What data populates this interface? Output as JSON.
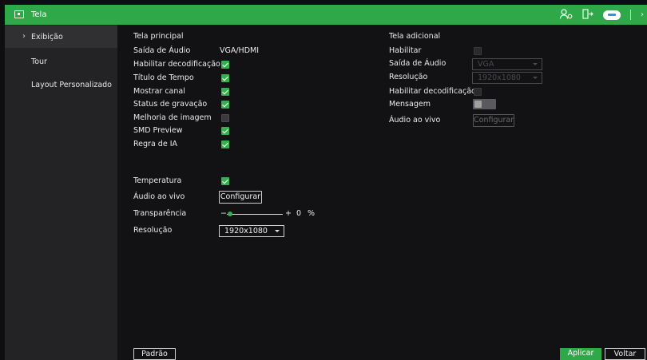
{
  "window": {
    "title": "Tela"
  },
  "titlebar": {
    "icons": [
      "user-settings-icon",
      "logout-icon",
      "cloud-icon",
      "expand-icon"
    ]
  },
  "sidebar": {
    "items": [
      {
        "label": "Exibição",
        "active": true
      },
      {
        "label": "Tour",
        "active": false
      },
      {
        "label": "Layout Personalizado",
        "active": false
      }
    ]
  },
  "main_screen": {
    "header": "Tela principal",
    "audio_output": {
      "label": "Saída de Áudio",
      "value": "VGA/HDMI"
    },
    "decoding": {
      "label": "Habilitar decodificação",
      "checked": true
    },
    "time_title": {
      "label": "Título de Tempo",
      "checked": true
    },
    "show_channel": {
      "label": "Mostrar canal",
      "checked": true
    },
    "record_status": {
      "label": "Status de gravação",
      "checked": true
    },
    "image_enhance": {
      "label": "Melhoria de imagem",
      "checked": false
    },
    "smd_preview": {
      "label": "SMD Preview",
      "checked": true
    },
    "ai_rule": {
      "label": "Regra de IA",
      "checked": true
    },
    "temperature": {
      "label": "Temperatura",
      "checked": true
    },
    "live_audio": {
      "label": "Áudio ao vivo",
      "button": "Configurar"
    },
    "transparency": {
      "label": "Transparência",
      "minus": "−",
      "plus": "+",
      "value": "0",
      "unit": "%"
    },
    "resolution": {
      "label": "Resolução",
      "value": "1920x1080"
    }
  },
  "extra_screen": {
    "header": "Tela adicional",
    "enable": {
      "label": "Habilitar",
      "checked": false
    },
    "audio_output": {
      "label": "Saída de Áudio",
      "value": "VGA"
    },
    "resolution": {
      "label": "Resolução",
      "value": "1920x1080"
    },
    "decoding": {
      "label": "Habilitar decodificação",
      "checked": false
    },
    "message": {
      "label": "Mensagem",
      "on": false
    },
    "live_audio": {
      "label": "Áudio ao vivo",
      "button": "Configurar"
    }
  },
  "footer": {
    "default_label": "Padrão",
    "apply_label": "Aplicar",
    "back_label": "Voltar"
  },
  "colors": {
    "accent": "#2fa84a",
    "check_on": "#35b04d",
    "background": "#121214",
    "sidebar": "#232325"
  }
}
